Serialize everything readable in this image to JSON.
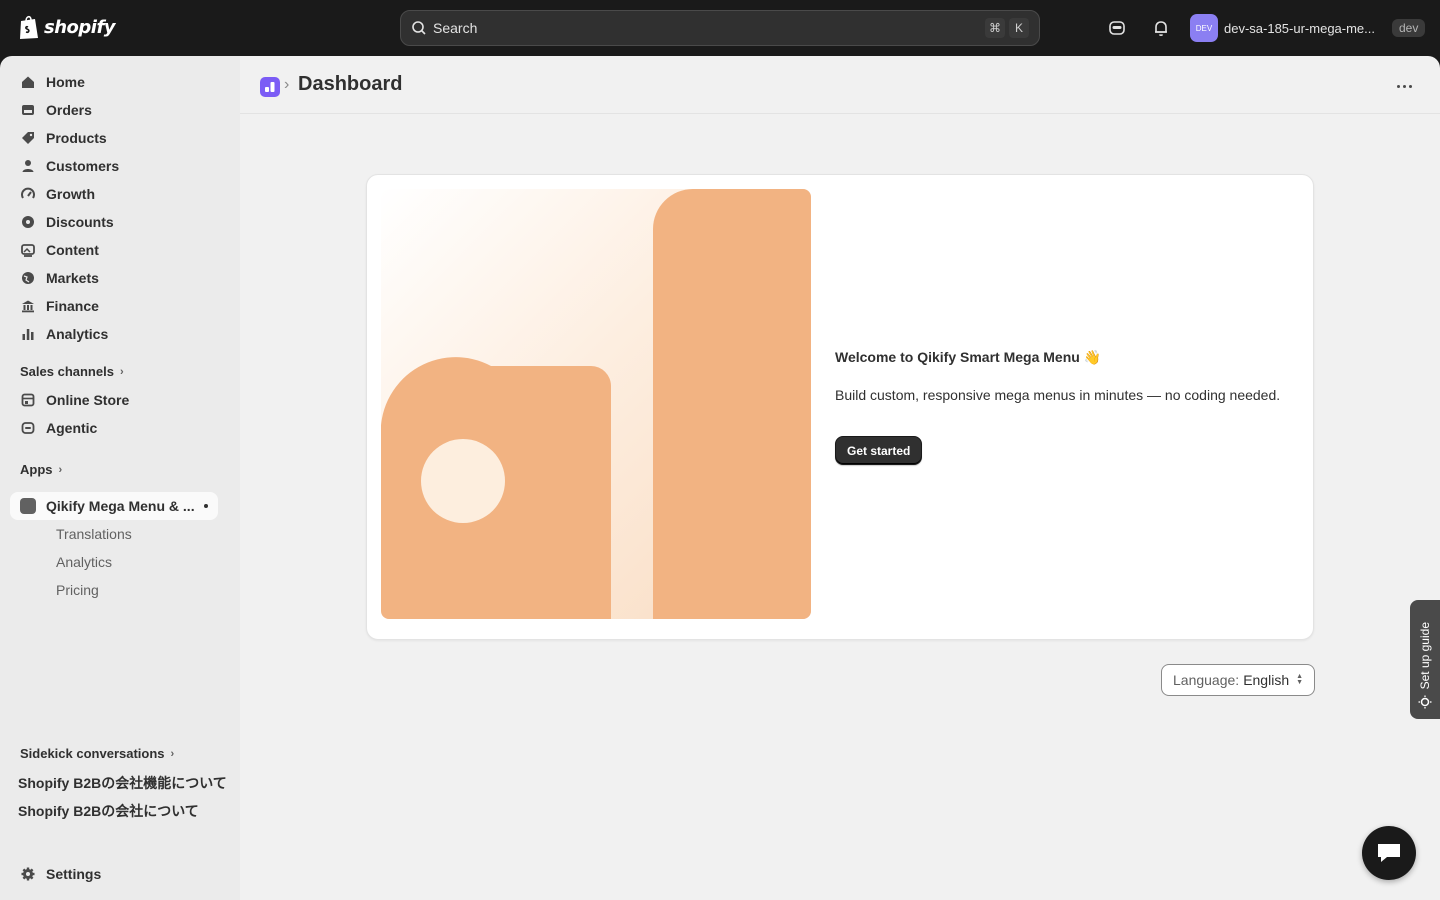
{
  "topbar": {
    "logo_text": "shopify",
    "search_placeholder": "Search",
    "shortcut_key1": "⌘",
    "shortcut_key2": "K",
    "account_initials": "DEV",
    "account_name": "dev-sa-185-ur-mega-me...",
    "store_badge": "dev"
  },
  "sidebar": {
    "nav": [
      {
        "label": "Home",
        "icon": "home-icon"
      },
      {
        "label": "Orders",
        "icon": "orders-icon"
      },
      {
        "label": "Products",
        "icon": "tag-icon"
      },
      {
        "label": "Customers",
        "icon": "person-icon"
      },
      {
        "label": "Growth",
        "icon": "gauge-icon"
      },
      {
        "label": "Discounts",
        "icon": "discount-icon"
      },
      {
        "label": "Content",
        "icon": "image-icon"
      },
      {
        "label": "Markets",
        "icon": "globe-icon"
      },
      {
        "label": "Finance",
        "icon": "bank-icon"
      },
      {
        "label": "Analytics",
        "icon": "bar-chart-icon"
      }
    ],
    "sales_channels_label": "Sales channels",
    "channels": [
      {
        "label": "Online Store",
        "icon": "store-icon"
      },
      {
        "label": "Agentic",
        "icon": "agentic-icon"
      }
    ],
    "apps_label": "Apps",
    "app": {
      "label": "Qikify Mega Menu & ...",
      "subitems": [
        "Translations",
        "Analytics",
        "Pricing"
      ]
    },
    "sidekick_label": "Sidekick conversations",
    "conversations": [
      "Shopify B2Bの会社機能について",
      "Shopify B2Bの会社について"
    ],
    "settings_label": "Settings"
  },
  "header": {
    "title": "Dashboard"
  },
  "welcome": {
    "title": "Welcome to Qikify Smart Mega Menu",
    "emoji": "👋",
    "description": "Build custom, responsive mega menus in minutes — no coding needed.",
    "cta_label": "Get started"
  },
  "language": {
    "prefix": "Language:",
    "value": "English"
  },
  "setup_guide_label": "Set up guide",
  "colors": {
    "illustration_peach": "#f2b382",
    "accent_purple": "#7b5cf5",
    "topbar": "#1a1a1a"
  }
}
